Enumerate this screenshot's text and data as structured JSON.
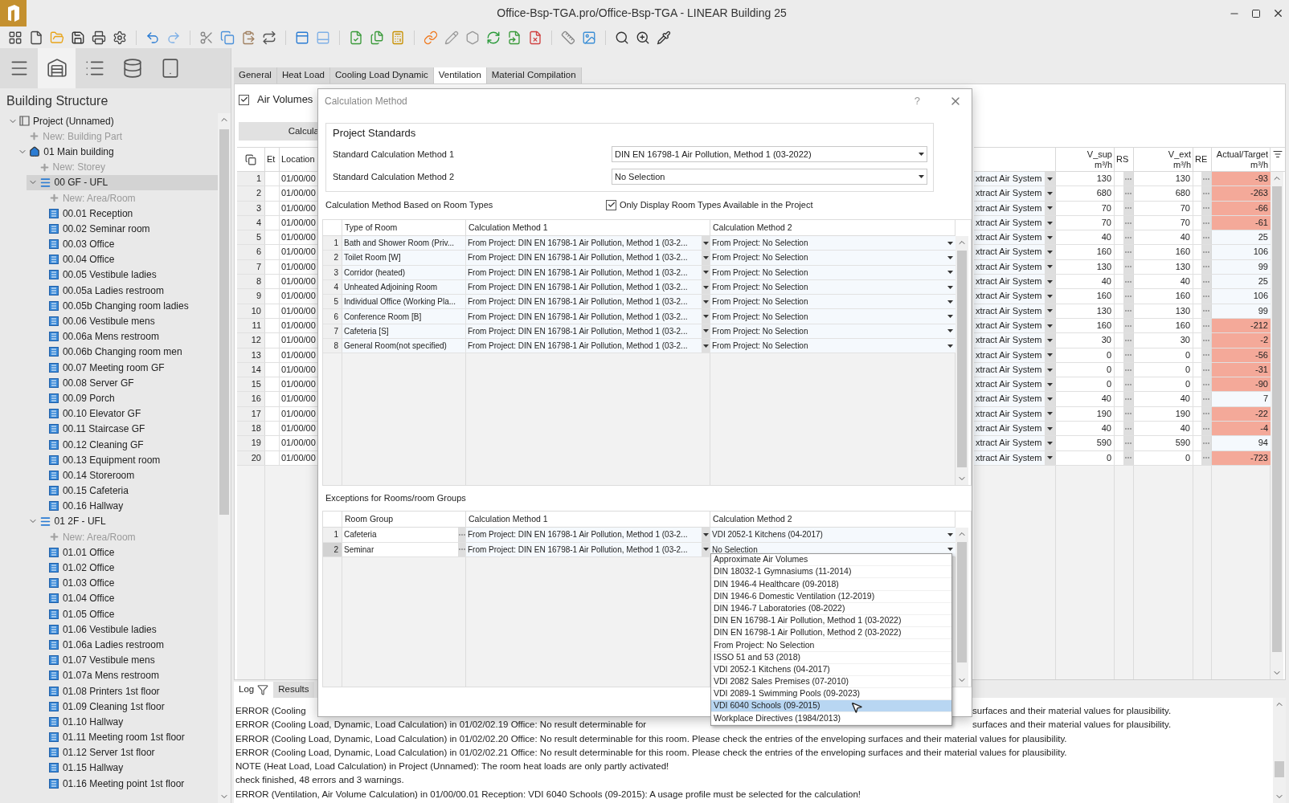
{
  "window": {
    "title": "Office-Bsp-TGA.pro/Office-Bsp-TGA - LINEAR Building 25"
  },
  "sidebar": {
    "view_tabs": [
      {
        "selected": false
      },
      {
        "selected": true
      },
      {
        "selected": false
      },
      {
        "selected": false
      },
      {
        "selected": false
      }
    ],
    "title": "Building Structure",
    "tree": [
      {
        "label": "Project (Unnamed)",
        "kind": "project",
        "selected": false,
        "expanded": true,
        "children": [
          {
            "label": "New: Building Part",
            "kind": "new",
            "selected": false
          },
          {
            "label": "01 Main building",
            "kind": "building",
            "selected": false,
            "expanded": true,
            "children": [
              {
                "label": "New: Storey",
                "kind": "new",
                "selected": false
              },
              {
                "label": "00 GF - UFL",
                "kind": "storey",
                "selected": true,
                "expanded": true,
                "children": [
                  {
                    "label": "New: Area/Room",
                    "kind": "new",
                    "selected": false
                  },
                  {
                    "label": "00.01 Reception",
                    "kind": "room",
                    "selected": false
                  },
                  {
                    "label": "00.02 Seminar room",
                    "kind": "room",
                    "selected": false
                  },
                  {
                    "label": "00.03 Office",
                    "kind": "room",
                    "selected": false
                  },
                  {
                    "label": "00.04 Office",
                    "kind": "room",
                    "selected": false
                  },
                  {
                    "label": "00.05 Vestibule ladies",
                    "kind": "room",
                    "selected": false
                  },
                  {
                    "label": "00.05a Ladies restroom",
                    "kind": "room",
                    "selected": false
                  },
                  {
                    "label": "00.05b Changing room ladies",
                    "kind": "room",
                    "selected": false
                  },
                  {
                    "label": "00.06 Vestibule mens",
                    "kind": "room",
                    "selected": false
                  },
                  {
                    "label": "00.06a Mens restroom",
                    "kind": "room",
                    "selected": false
                  },
                  {
                    "label": "00.06b Changing room men",
                    "kind": "room",
                    "selected": false
                  },
                  {
                    "label": "00.07 Meeting room GF",
                    "kind": "room",
                    "selected": false
                  },
                  {
                    "label": "00.08 Server GF",
                    "kind": "room",
                    "selected": false
                  },
                  {
                    "label": "00.09 Porch",
                    "kind": "room",
                    "selected": false
                  },
                  {
                    "label": "00.10 Elevator GF",
                    "kind": "room",
                    "selected": false
                  },
                  {
                    "label": "00.11 Staircase GF",
                    "kind": "room",
                    "selected": false
                  },
                  {
                    "label": "00.12 Cleaning GF",
                    "kind": "room",
                    "selected": false
                  },
                  {
                    "label": "00.13 Equipment room",
                    "kind": "room",
                    "selected": false
                  },
                  {
                    "label": "00.14 Storeroom",
                    "kind": "room",
                    "selected": false
                  },
                  {
                    "label": "00.15 Cafeteria",
                    "kind": "room",
                    "selected": false
                  },
                  {
                    "label": "00.16 Hallway",
                    "kind": "room",
                    "selected": false
                  }
                ]
              },
              {
                "label": "01 2F - UFL",
                "kind": "storey",
                "selected": false,
                "expanded": true,
                "children": [
                  {
                    "label": "New: Area/Room",
                    "kind": "new",
                    "selected": false
                  },
                  {
                    "label": "01.01 Office",
                    "kind": "room",
                    "selected": false
                  },
                  {
                    "label": "01.02 Office",
                    "kind": "room",
                    "selected": false
                  },
                  {
                    "label": "01.03 Office",
                    "kind": "room",
                    "selected": false
                  },
                  {
                    "label": "01.04 Office",
                    "kind": "room",
                    "selected": false
                  },
                  {
                    "label": "01.05 Office",
                    "kind": "room",
                    "selected": false
                  },
                  {
                    "label": "01.06 Vestibule ladies",
                    "kind": "room",
                    "selected": false
                  },
                  {
                    "label": "01.06a Ladies restroom",
                    "kind": "room",
                    "selected": false
                  },
                  {
                    "label": "01.07 Vestibule mens",
                    "kind": "room",
                    "selected": false
                  },
                  {
                    "label": "01.07a Mens restroom",
                    "kind": "room",
                    "selected": false
                  },
                  {
                    "label": "01.08 Printers 1st floor",
                    "kind": "room",
                    "selected": false
                  },
                  {
                    "label": "01.09 Cleaning 1st floor",
                    "kind": "room",
                    "selected": false
                  },
                  {
                    "label": "01.10 Hallway",
                    "kind": "room",
                    "selected": false
                  },
                  {
                    "label": "01.11 Meeting room 1st floor",
                    "kind": "room",
                    "selected": false
                  },
                  {
                    "label": "01.12 Server 1st floor",
                    "kind": "room",
                    "selected": false
                  },
                  {
                    "label": "01.15 Hallway",
                    "kind": "room",
                    "selected": false
                  },
                  {
                    "label": "01.16 Meeting point 1st floor",
                    "kind": "room",
                    "selected": false
                  }
                ]
              }
            ]
          }
        ]
      }
    ]
  },
  "tabs": [
    {
      "label": "General",
      "selected": false
    },
    {
      "label": "Heat Load",
      "selected": false
    },
    {
      "label": "Cooling Load Dynamic",
      "selected": false
    },
    {
      "label": "Ventilation",
      "selected": true
    },
    {
      "label": "Material Compilation",
      "selected": false
    }
  ],
  "air_volumes": {
    "label": "Air Volumes",
    "checked": true
  },
  "calculate_button": "Calcula",
  "table": {
    "left_columns": [
      "Et",
      "Location"
    ],
    "right_columns": [
      {
        "name": "V_sup",
        "unit": "m³/h"
      },
      {
        "name": "RS"
      },
      {
        "name": "V_ext",
        "unit": "m³/h"
      },
      {
        "name": "RE"
      },
      {
        "name": "Actual/Target",
        "unit": "m³/h"
      }
    ],
    "rows": [
      {
        "number": "1",
        "location": "01/00/00",
        "system": "xtract Air System",
        "v_sup": "130",
        "v_ext": "130",
        "actual_target": "-93",
        "alert": true
      },
      {
        "number": "2",
        "location": "01/00/00",
        "system": "xtract Air System",
        "v_sup": "680",
        "v_ext": "680",
        "actual_target": "-263",
        "alert": true
      },
      {
        "number": "3",
        "location": "01/00/00",
        "system": "xtract Air System",
        "v_sup": "70",
        "v_ext": "70",
        "actual_target": "-66",
        "alert": true
      },
      {
        "number": "4",
        "location": "01/00/00",
        "system": "xtract Air System",
        "v_sup": "70",
        "v_ext": "70",
        "actual_target": "-61",
        "alert": true
      },
      {
        "number": "5",
        "location": "01/00/00",
        "system": "xtract Air System",
        "v_sup": "40",
        "v_ext": "40",
        "actual_target": "25",
        "alert": false
      },
      {
        "number": "6",
        "location": "01/00/00",
        "system": "xtract Air System",
        "v_sup": "160",
        "v_ext": "160",
        "actual_target": "106",
        "alert": false
      },
      {
        "number": "7",
        "location": "01/00/00",
        "system": "xtract Air System",
        "v_sup": "130",
        "v_ext": "130",
        "actual_target": "99",
        "alert": false
      },
      {
        "number": "8",
        "location": "01/00/00",
        "system": "xtract Air System",
        "v_sup": "40",
        "v_ext": "40",
        "actual_target": "25",
        "alert": false
      },
      {
        "number": "9",
        "location": "01/00/00",
        "system": "xtract Air System",
        "v_sup": "160",
        "v_ext": "160",
        "actual_target": "106",
        "alert": false
      },
      {
        "number": "10",
        "location": "01/00/00",
        "system": "xtract Air System",
        "v_sup": "130",
        "v_ext": "130",
        "actual_target": "99",
        "alert": false
      },
      {
        "number": "11",
        "location": "01/00/00",
        "system": "xtract Air System",
        "v_sup": "160",
        "v_ext": "160",
        "actual_target": "-212",
        "alert": true
      },
      {
        "number": "12",
        "location": "01/00/00",
        "system": "xtract Air System",
        "v_sup": "30",
        "v_ext": "30",
        "actual_target": "-2",
        "alert": true
      },
      {
        "number": "13",
        "location": "01/00/00",
        "system": "xtract Air System",
        "v_sup": "0",
        "v_ext": "0",
        "actual_target": "-56",
        "alert": true
      },
      {
        "number": "14",
        "location": "01/00/00",
        "system": "xtract Air System",
        "v_sup": "0",
        "v_ext": "0",
        "actual_target": "-31",
        "alert": true
      },
      {
        "number": "15",
        "location": "01/00/00",
        "system": "xtract Air System",
        "v_sup": "0",
        "v_ext": "0",
        "actual_target": "-90",
        "alert": true
      },
      {
        "number": "16",
        "location": "01/00/00",
        "system": "xtract Air System",
        "v_sup": "40",
        "v_ext": "40",
        "actual_target": "7",
        "alert": false
      },
      {
        "number": "17",
        "location": "01/00/00",
        "system": "xtract Air System",
        "v_sup": "190",
        "v_ext": "190",
        "actual_target": "-22",
        "alert": true
      },
      {
        "number": "18",
        "location": "01/00/00",
        "system": "xtract Air System",
        "v_sup": "40",
        "v_ext": "40",
        "actual_target": "-4",
        "alert": true
      },
      {
        "number": "19",
        "location": "01/00/00",
        "system": "xtract Air System",
        "v_sup": "590",
        "v_ext": "590",
        "actual_target": "94",
        "alert": false
      },
      {
        "number": "20",
        "location": "01/00/00",
        "system": "xtract Air System",
        "v_sup": "0",
        "v_ext": "0",
        "actual_target": "-723",
        "alert": true
      }
    ]
  },
  "dialog": {
    "title": "Calculation Method",
    "help": "?",
    "standards": {
      "title": "Project Standards",
      "fields": [
        {
          "label": "Standard Calculation Method 1",
          "value": "DIN EN 16798-1 Air Pollution, Method 1 (03-2022)"
        },
        {
          "label": "Standard Calculation Method 2",
          "value": "No Selection"
        }
      ]
    },
    "room_types": {
      "title": "Calculation Method Based on Room Types",
      "filter": {
        "label": "Only Display Room Types Available in the Project",
        "checked": true
      },
      "columns": [
        "Type of Room",
        "Calculation Method 1",
        "Calculation Method 2"
      ],
      "rows": [
        {
          "number": "1",
          "type": "Bath and Shower Room (Priv...",
          "method_1": "From Project: DIN EN 16798-1 Air Pollution, Method 1 (03-2...",
          "method_2": "From Project: No Selection"
        },
        {
          "number": "2",
          "type": "Toilet Room [W]",
          "method_1": "From Project: DIN EN 16798-1 Air Pollution, Method 1 (03-2...",
          "method_2": "From Project: No Selection"
        },
        {
          "number": "3",
          "type": "Corridor (heated)",
          "method_1": "From Project: DIN EN 16798-1 Air Pollution, Method 1 (03-2...",
          "method_2": "From Project: No Selection"
        },
        {
          "number": "4",
          "type": "Unheated Adjoining Room",
          "method_1": "From Project: DIN EN 16798-1 Air Pollution, Method 1 (03-2...",
          "method_2": "From Project: No Selection"
        },
        {
          "number": "5",
          "type": "Individual Office (Working Pla...",
          "method_1": "From Project: DIN EN 16798-1 Air Pollution, Method 1 (03-2...",
          "method_2": "From Project: No Selection"
        },
        {
          "number": "6",
          "type": "Conference Room [B]",
          "method_1": "From Project: DIN EN 16798-1 Air Pollution, Method 1 (03-2...",
          "method_2": "From Project: No Selection"
        },
        {
          "number": "7",
          "type": "Cafeteria [S]",
          "method_1": "From Project: DIN EN 16798-1 Air Pollution, Method 1 (03-2...",
          "method_2": "From Project: No Selection"
        },
        {
          "number": "8",
          "type": "General Room(not specified)",
          "method_1": "From Project: DIN EN 16798-1 Air Pollution, Method 1 (03-2...",
          "method_2": "From Project: No Selection"
        }
      ]
    },
    "exceptions": {
      "title": "Exceptions for Rooms/room Groups",
      "columns": [
        "Room Group",
        "Calculation Method 1",
        "Calculation Method 2"
      ],
      "rows": [
        {
          "number": "1",
          "group": "Cafeteria",
          "method_1": "From Project: DIN EN 16798-1 Air Pollution, Method 1 (03-2...",
          "method_2": "VDI 2052-1 Kitchens (04-2017)",
          "selected": false
        },
        {
          "number": "2",
          "group": "Seminar",
          "method_1": "From Project: DIN EN 16798-1 Air Pollution, Method 1 (03-2...",
          "method_2": "No Selection",
          "selected": true
        }
      ],
      "dropdown": [
        {
          "label": "Approximate Air Volumes",
          "selected": false
        },
        {
          "label": "DIN 18032-1 Gymnasiums (11-2014)",
          "selected": false
        },
        {
          "label": "DIN 1946-4 Healthcare (09-2018)",
          "selected": false
        },
        {
          "label": "DIN 1946-6 Domestic Ventilation (12-2019)",
          "selected": false
        },
        {
          "label": "DIN 1946-7 Laboratories (08-2022)",
          "selected": false
        },
        {
          "label": "DIN EN 16798-1 Air Pollution, Method 1 (03-2022)",
          "selected": false
        },
        {
          "label": "DIN EN 16798-1 Air Pollution, Method 2 (03-2022)",
          "selected": false
        },
        {
          "label": "From Project: No Selection",
          "selected": false
        },
        {
          "label": "ISSO 51 and 53 (2018)",
          "selected": false
        },
        {
          "label": "VDI 2052-1 Kitchens (04-2017)",
          "selected": false
        },
        {
          "label": "VDI 2082 Sales Premises (07-2010)",
          "selected": false
        },
        {
          "label": "VDI 2089-1 Swimming Pools (09-2023)",
          "selected": false
        },
        {
          "label": "VDI 6040 Schools (09-2015)",
          "selected": true
        },
        {
          "label": "Workplace Directives (1984/2013)",
          "selected": false
        }
      ]
    }
  },
  "log": {
    "tabs": [
      {
        "label": "Log",
        "selected": true
      },
      {
        "label": "Results",
        "selected": false
      }
    ],
    "lines": [
      {
        "segments": [
          "ERROR (Cooling",
          "surfaces and their material values for plausibility."
        ]
      },
      {
        "segments": [
          "ERROR (Cooling Load, Dynamic, Load Calculation) in 01/02/02.19 Office: No result determinable for",
          "surfaces and their material values for plausibility."
        ]
      },
      {
        "segments": [
          "ERROR (Cooling Load, Dynamic, Load Calculation) in 01/02/02.20 Office: No result determinable for this room. Please check the entries of the enveloping surfaces and their material values for plausibility."
        ]
      },
      {
        "segments": [
          "ERROR (Cooling Load, Dynamic, Load Calculation) in 01/02/02.21 Office: No result determinable for this room. Please check the entries of the enveloping surfaces and their material values for plausibility."
        ]
      },
      {
        "segments": [
          "NOTE (Heat Load, Load Calculation) in Project (Unnamed): The room heat loads are only partly activated!"
        ]
      },
      {
        "segments": [
          "check finished, 48 errors and 3 warnings."
        ]
      },
      {
        "segments": [
          "ERROR (Ventilation, Air Volume Calculation) in 01/00/00.01 Reception: VDI 6040 Schools (09-2015): A usage profile must be selected for the calculation!"
        ]
      }
    ]
  }
}
